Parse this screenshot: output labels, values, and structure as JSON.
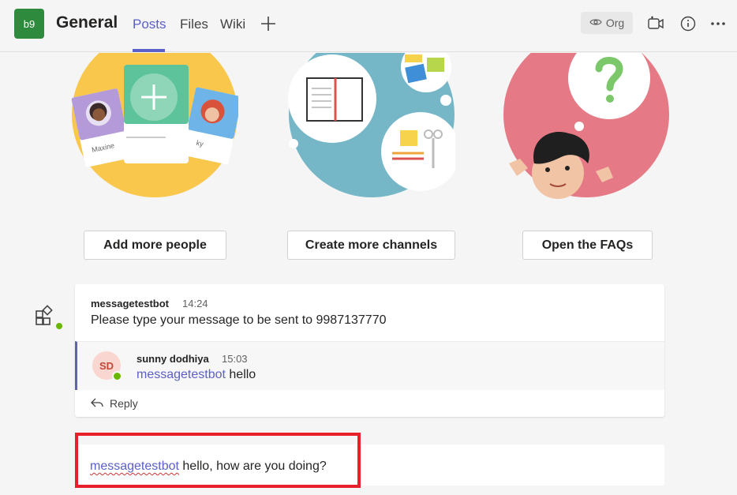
{
  "header": {
    "team_initials": "b9",
    "channel_name": "General",
    "tabs": [
      {
        "label": "Posts",
        "active": true
      },
      {
        "label": "Files",
        "active": false
      },
      {
        "label": "Wiki",
        "active": false
      }
    ],
    "add_tab_icon": "plus-icon",
    "org_label": "Org",
    "org_icon": "eye-icon",
    "right_icons": [
      "meet-video-icon",
      "info-icon",
      "more-options-icon"
    ]
  },
  "illustrations": [
    {
      "name": "people-cards-illustration",
      "card_name": "Maxine",
      "card_name_2": "ky"
    },
    {
      "name": "channels-illustration"
    },
    {
      "name": "faq-illustration"
    }
  ],
  "actions": [
    {
      "label": "Add more people"
    },
    {
      "label": "Create more channels"
    },
    {
      "label": "Open the FAQs"
    }
  ],
  "message": {
    "author": "messagetestbot",
    "time": "14:24",
    "body": "Please type your message to be sent to 9987137770",
    "reply": {
      "initials": "SD",
      "author": "sunny dodhiya",
      "time": "15:03",
      "mention": "messagetestbot",
      "text": " hello"
    },
    "reply_label": "Reply"
  },
  "compose": {
    "mention": "messagetestbot",
    "text": " hello, how are you doing?"
  },
  "colors": {
    "accent": "#5b5fc7",
    "team_avatar": "#2e8b3e",
    "highlight": "#e8202a",
    "status_available": "#6bb700"
  }
}
